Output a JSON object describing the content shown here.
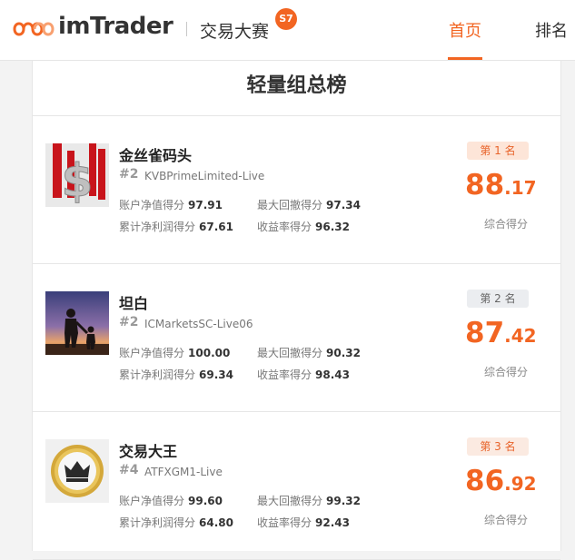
{
  "header": {
    "logo_text": "imTrader",
    "event_title": "交易大赛",
    "season_badge": "S7",
    "nav": [
      {
        "label": "首页",
        "active": true
      },
      {
        "label": "排名",
        "active": false
      }
    ]
  },
  "colors": {
    "accent": "#f26522"
  },
  "leaderboard": {
    "title": "轻量组总榜",
    "entries": [
      {
        "name": "金丝雀码头",
        "rank_no": "#2",
        "account": "KVBPrimeLimited-Live",
        "place_label": "第 1 名",
        "score_int": "88",
        "score_dec": ".17",
        "score_label": "综合得分",
        "avatar_icon": "dollar-sign-avatar",
        "stats": [
          {
            "label": "账户净值得分",
            "value": "97.91"
          },
          {
            "label": "最大回撤得分",
            "value": "97.34"
          },
          {
            "label": "累计净利润得分",
            "value": "67.61"
          },
          {
            "label": "收益率得分",
            "value": "96.32"
          }
        ]
      },
      {
        "name": "坦白",
        "rank_no": "#2",
        "account": "ICMarketsSC-Live06",
        "place_label": "第 2 名",
        "score_int": "87",
        "score_dec": ".42",
        "score_label": "综合得分",
        "avatar_icon": "sunset-silhouette-avatar",
        "stats": [
          {
            "label": "账户净值得分",
            "value": "100.00"
          },
          {
            "label": "最大回撤得分",
            "value": "90.32"
          },
          {
            "label": "累计净利润得分",
            "value": "69.34"
          },
          {
            "label": "收益率得分",
            "value": "98.43"
          }
        ]
      },
      {
        "name": "交易大王",
        "rank_no": "#4",
        "account": "ATFXGM1-Live",
        "place_label": "第 3 名",
        "score_int": "86",
        "score_dec": ".92",
        "score_label": "综合得分",
        "avatar_icon": "crown-medal-avatar",
        "stats": [
          {
            "label": "账户净值得分",
            "value": "99.60"
          },
          {
            "label": "最大回撤得分",
            "value": "99.32"
          },
          {
            "label": "累计净利润得分",
            "value": "64.80"
          },
          {
            "label": "收益率得分",
            "value": "92.43"
          }
        ]
      }
    ]
  }
}
